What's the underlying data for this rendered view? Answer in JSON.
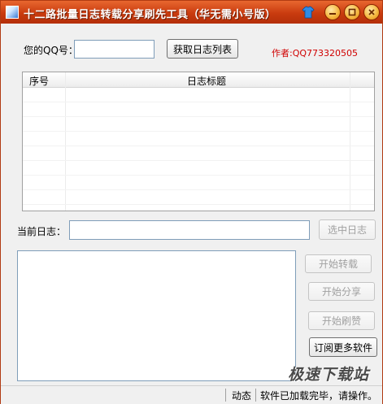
{
  "window": {
    "title": "十二路批量日志转载分享刷先工具（华无需小号版）"
  },
  "form": {
    "qq_label": "您的QQ号：",
    "qq_value": "",
    "fetch_button": "获取日志列表",
    "author": "作者:QQ773320505",
    "current_log_label": "当前日志：",
    "current_log_value": "",
    "select_log_button": "选中日志"
  },
  "list": {
    "columns": [
      "序号",
      "日志标题"
    ],
    "rows": []
  },
  "actions": {
    "start_repost": "开始转载",
    "start_share": "开始分享",
    "start_like": "开始刷赞",
    "subscribe": "订阅更多软件"
  },
  "statusbar": {
    "label": "动态",
    "message": "软件已加载完毕，请操作。"
  },
  "watermark": "极速下载站",
  "colors": {
    "titlebar": "#c93b0f",
    "author_text": "#d00000"
  },
  "icons": [
    "app-icon",
    "skin-icon",
    "minimize-icon",
    "restore-icon",
    "close-icon"
  ]
}
